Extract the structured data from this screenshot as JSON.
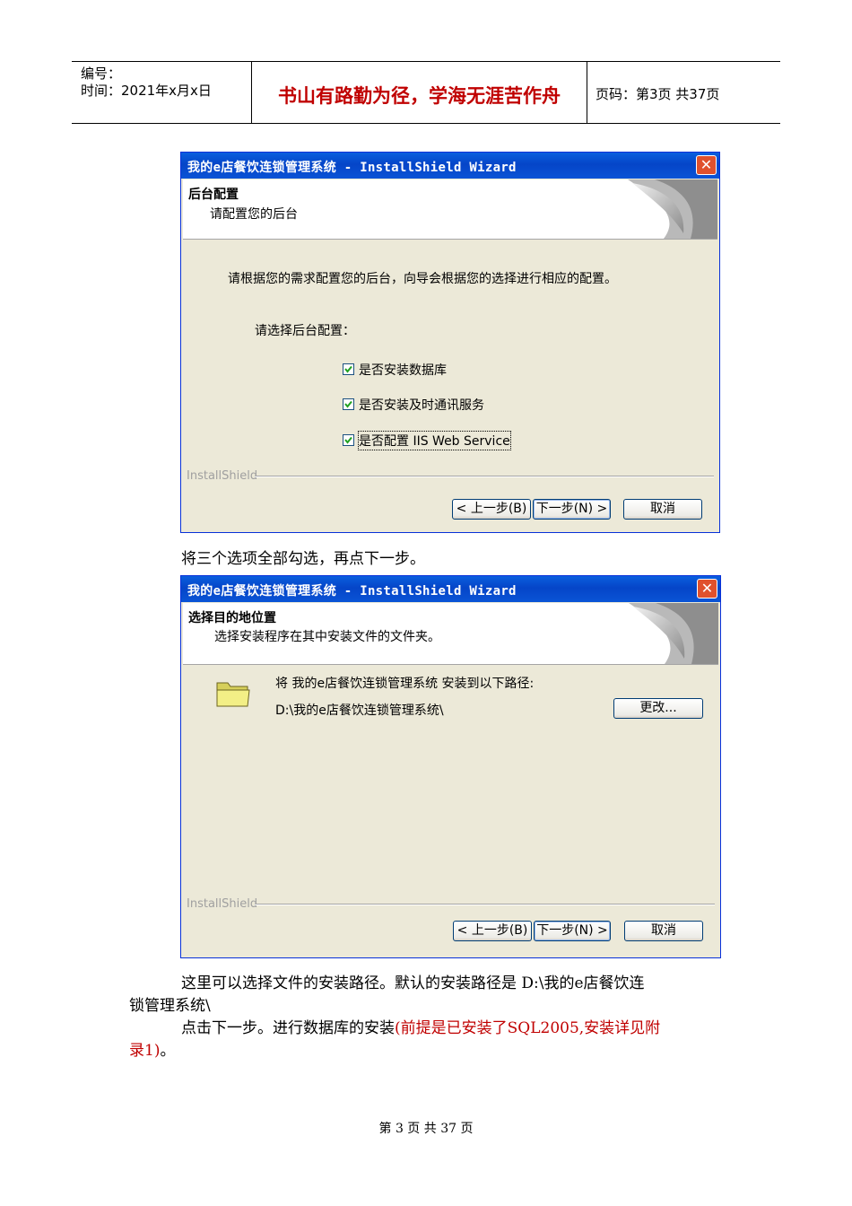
{
  "header": {
    "number_label": "编号：",
    "time_label": "时间：2021年x月x日",
    "motto": "书山有路勤为径，学海无涯苦作舟",
    "page_info": "页码：第3页  共37页"
  },
  "dialog1": {
    "title": "我的e店餐饮连锁管理系统 - InstallShield Wizard",
    "banner_title": "后台配置",
    "banner_subtitle": "请配置您的后台",
    "description": "请根据您的需求配置您的后台，向导会根据您的选择进行相应的配置。",
    "group_label": "请选择后台配置：",
    "options": [
      {
        "label": "是否安装数据库",
        "checked": true
      },
      {
        "label": "是否安装及时通讯服务",
        "checked": true
      },
      {
        "label": "是否配置 IIS Web Service",
        "checked": true
      }
    ],
    "brand": "InstallShield",
    "back_button": "< 上一步(B)",
    "next_button": "下一步(N) >",
    "cancel_button": "取消"
  },
  "caption1": "将三个选项全部勾选，再点下一步。",
  "dialog2": {
    "title": "我的e店餐饮连锁管理系统 - InstallShield Wizard",
    "banner_title": "选择目的地位置",
    "banner_subtitle": "选择安装程序在其中安装文件的文件夹。",
    "install_to": "将 我的e店餐饮连锁管理系统 安装到以下路径:",
    "path": "D:\\我的e店餐饮连锁管理系统\\",
    "change_button": "更改...",
    "brand": "InstallShield",
    "back_button": "< 上一步(B)",
    "next_button": "下一步(N) >",
    "cancel_button": "取消"
  },
  "para1_line1": "这里可以选择文件的安装路径。默认的安装路径是 D:\\我的e店餐饮连",
  "para1_line2": "锁管理系统\\",
  "para2_normal": "点击下一步。进行数据库的安装",
  "para2_red_line1": "(前提是已安装了SQL2005,安装详见附",
  "para2_red_line2": "录1)",
  "para2_end": "。",
  "footer": "第 3 页 共 37 页"
}
